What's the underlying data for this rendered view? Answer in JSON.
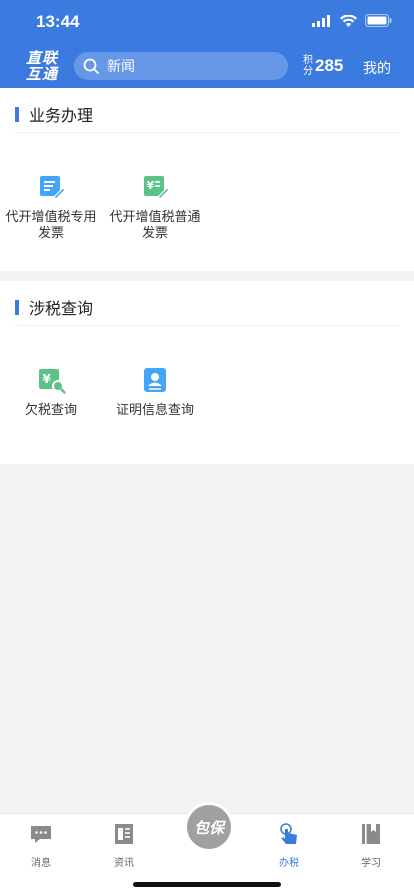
{
  "status": {
    "time": "13:44"
  },
  "header": {
    "logo_line1": "直联",
    "logo_line2": "互通",
    "search_placeholder": "新闻",
    "points_label": "积分",
    "points_value": "285",
    "mine_label": "我的"
  },
  "sections": [
    {
      "title": "业务办理",
      "items": [
        {
          "label": "代开增值税专用发票",
          "icon": "invoice-special-icon"
        },
        {
          "label": "代开增值税普通发票",
          "icon": "invoice-general-icon"
        }
      ]
    },
    {
      "title": "涉税查询",
      "items": [
        {
          "label": "欠税查询",
          "icon": "tax-query-icon"
        },
        {
          "label": "证明信息查询",
          "icon": "certificate-query-icon"
        }
      ]
    }
  ],
  "tabbar": {
    "center_label": "包保",
    "tabs": [
      {
        "label": "消息",
        "icon": "message-icon"
      },
      {
        "label": "资讯",
        "icon": "news-icon"
      },
      {
        "label": "办税",
        "icon": "tap-icon",
        "active": true
      },
      {
        "label": "学习",
        "icon": "book-icon"
      }
    ]
  },
  "colors": {
    "brand": "#3b7be0",
    "green": "#5cc28a",
    "blue_icon": "#42a5f5",
    "tab_inactive": "#8a8a8a"
  }
}
